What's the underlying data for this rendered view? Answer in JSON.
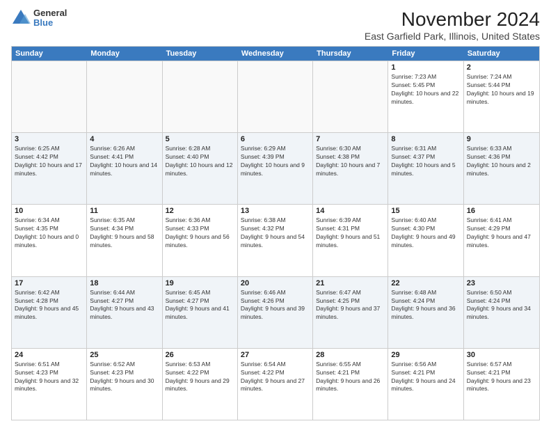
{
  "logo": {
    "general": "General",
    "blue": "Blue"
  },
  "title": "November 2024",
  "subtitle": "East Garfield Park, Illinois, United States",
  "header_days": [
    "Sunday",
    "Monday",
    "Tuesday",
    "Wednesday",
    "Thursday",
    "Friday",
    "Saturday"
  ],
  "rows": [
    [
      {
        "day": "",
        "info": "",
        "empty": true
      },
      {
        "day": "",
        "info": "",
        "empty": true
      },
      {
        "day": "",
        "info": "",
        "empty": true
      },
      {
        "day": "",
        "info": "",
        "empty": true
      },
      {
        "day": "",
        "info": "",
        "empty": true
      },
      {
        "day": "1",
        "info": "Sunrise: 7:23 AM\nSunset: 5:45 PM\nDaylight: 10 hours and 22 minutes."
      },
      {
        "day": "2",
        "info": "Sunrise: 7:24 AM\nSunset: 5:44 PM\nDaylight: 10 hours and 19 minutes."
      }
    ],
    [
      {
        "day": "3",
        "info": "Sunrise: 6:25 AM\nSunset: 4:42 PM\nDaylight: 10 hours and 17 minutes."
      },
      {
        "day": "4",
        "info": "Sunrise: 6:26 AM\nSunset: 4:41 PM\nDaylight: 10 hours and 14 minutes."
      },
      {
        "day": "5",
        "info": "Sunrise: 6:28 AM\nSunset: 4:40 PM\nDaylight: 10 hours and 12 minutes."
      },
      {
        "day": "6",
        "info": "Sunrise: 6:29 AM\nSunset: 4:39 PM\nDaylight: 10 hours and 9 minutes."
      },
      {
        "day": "7",
        "info": "Sunrise: 6:30 AM\nSunset: 4:38 PM\nDaylight: 10 hours and 7 minutes."
      },
      {
        "day": "8",
        "info": "Sunrise: 6:31 AM\nSunset: 4:37 PM\nDaylight: 10 hours and 5 minutes."
      },
      {
        "day": "9",
        "info": "Sunrise: 6:33 AM\nSunset: 4:36 PM\nDaylight: 10 hours and 2 minutes."
      }
    ],
    [
      {
        "day": "10",
        "info": "Sunrise: 6:34 AM\nSunset: 4:35 PM\nDaylight: 10 hours and 0 minutes."
      },
      {
        "day": "11",
        "info": "Sunrise: 6:35 AM\nSunset: 4:34 PM\nDaylight: 9 hours and 58 minutes."
      },
      {
        "day": "12",
        "info": "Sunrise: 6:36 AM\nSunset: 4:33 PM\nDaylight: 9 hours and 56 minutes."
      },
      {
        "day": "13",
        "info": "Sunrise: 6:38 AM\nSunset: 4:32 PM\nDaylight: 9 hours and 54 minutes."
      },
      {
        "day": "14",
        "info": "Sunrise: 6:39 AM\nSunset: 4:31 PM\nDaylight: 9 hours and 51 minutes."
      },
      {
        "day": "15",
        "info": "Sunrise: 6:40 AM\nSunset: 4:30 PM\nDaylight: 9 hours and 49 minutes."
      },
      {
        "day": "16",
        "info": "Sunrise: 6:41 AM\nSunset: 4:29 PM\nDaylight: 9 hours and 47 minutes."
      }
    ],
    [
      {
        "day": "17",
        "info": "Sunrise: 6:42 AM\nSunset: 4:28 PM\nDaylight: 9 hours and 45 minutes."
      },
      {
        "day": "18",
        "info": "Sunrise: 6:44 AM\nSunset: 4:27 PM\nDaylight: 9 hours and 43 minutes."
      },
      {
        "day": "19",
        "info": "Sunrise: 6:45 AM\nSunset: 4:27 PM\nDaylight: 9 hours and 41 minutes."
      },
      {
        "day": "20",
        "info": "Sunrise: 6:46 AM\nSunset: 4:26 PM\nDaylight: 9 hours and 39 minutes."
      },
      {
        "day": "21",
        "info": "Sunrise: 6:47 AM\nSunset: 4:25 PM\nDaylight: 9 hours and 37 minutes."
      },
      {
        "day": "22",
        "info": "Sunrise: 6:48 AM\nSunset: 4:24 PM\nDaylight: 9 hours and 36 minutes."
      },
      {
        "day": "23",
        "info": "Sunrise: 6:50 AM\nSunset: 4:24 PM\nDaylight: 9 hours and 34 minutes."
      }
    ],
    [
      {
        "day": "24",
        "info": "Sunrise: 6:51 AM\nSunset: 4:23 PM\nDaylight: 9 hours and 32 minutes."
      },
      {
        "day": "25",
        "info": "Sunrise: 6:52 AM\nSunset: 4:23 PM\nDaylight: 9 hours and 30 minutes."
      },
      {
        "day": "26",
        "info": "Sunrise: 6:53 AM\nSunset: 4:22 PM\nDaylight: 9 hours and 29 minutes."
      },
      {
        "day": "27",
        "info": "Sunrise: 6:54 AM\nSunset: 4:22 PM\nDaylight: 9 hours and 27 minutes."
      },
      {
        "day": "28",
        "info": "Sunrise: 6:55 AM\nSunset: 4:21 PM\nDaylight: 9 hours and 26 minutes."
      },
      {
        "day": "29",
        "info": "Sunrise: 6:56 AM\nSunset: 4:21 PM\nDaylight: 9 hours and 24 minutes."
      },
      {
        "day": "30",
        "info": "Sunrise: 6:57 AM\nSunset: 4:21 PM\nDaylight: 9 hours and 23 minutes."
      }
    ]
  ]
}
